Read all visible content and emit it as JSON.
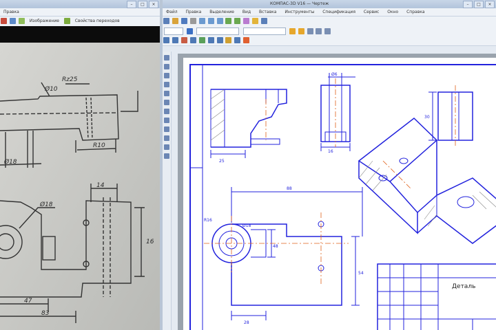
{
  "left_window": {
    "title": "",
    "menu": [
      "Правка"
    ],
    "toolbar": {
      "button1": "Изображение",
      "button2": "Свойства переходов"
    }
  },
  "right_window": {
    "title": "КОМПАС-3D V16 — Чертеж",
    "menu": [
      "Файл",
      "Правка",
      "Выделение",
      "Вид",
      "Вставка",
      "Инструменты",
      "Спецификация",
      "Сервис",
      "Окно",
      "Справка"
    ]
  },
  "drawing": {
    "photo_dims": [
      "Rz25",
      "Ø10",
      "Ø18",
      "R10",
      "47",
      "83",
      "14",
      "16"
    ],
    "sheet_dims": [
      "Ø6",
      "25",
      "48",
      "88",
      "54",
      "16",
      "28",
      "R16",
      "Ø18",
      "30"
    ],
    "title_block": "Деталь"
  },
  "colors": {
    "accent": "#2222dd",
    "axis": "#e0601a",
    "hatch": "#888888",
    "titlebar": "#b9c9dd"
  }
}
